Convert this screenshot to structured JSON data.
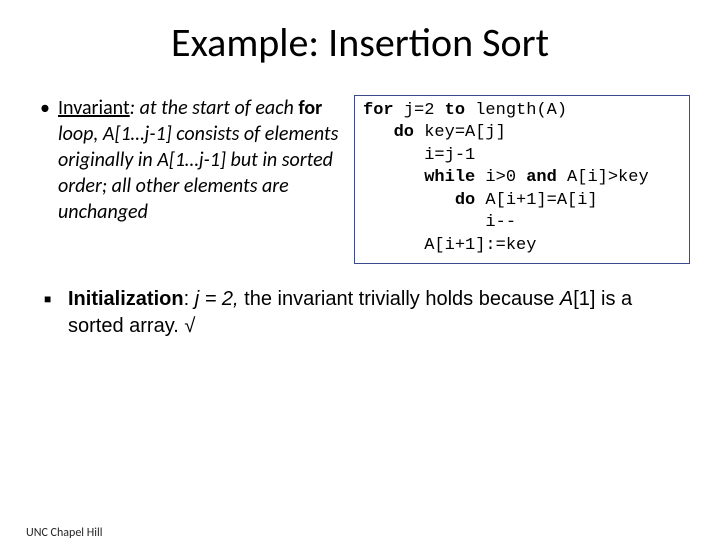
{
  "title": "Example: Insertion Sort",
  "invariant": {
    "label": "Invariant",
    "pre": ": at the start of each ",
    "for": "for",
    "mid1": " loop, A[1…j-1] consists of elements originally in A[1…j-1] but in sorted order; all other elements are unchanged"
  },
  "code": {
    "l1a": "for",
    "l1b": " j=2 ",
    "l1c": "to",
    "l1d": " length(A)",
    "l2a": "   do",
    "l2b": " key=A[j]",
    "l3": "      i=j-1",
    "l4a": "      while",
    "l4b": " i>0 ",
    "l4c": "and",
    "l4d": " A[i]>key",
    "l5a": "         do",
    "l5b": " A[i+1]=A[i]",
    "l6": "            i--",
    "l7": "      A[i+1]:=key"
  },
  "init": {
    "label": "Initialization",
    "sep": ": ",
    "j2": "j = 2,",
    "rest1": " the invariant trivially holds because ",
    "arr": "A",
    "rest2": "[1] is a sorted array. √"
  },
  "footer": "UNC Chapel Hill"
}
